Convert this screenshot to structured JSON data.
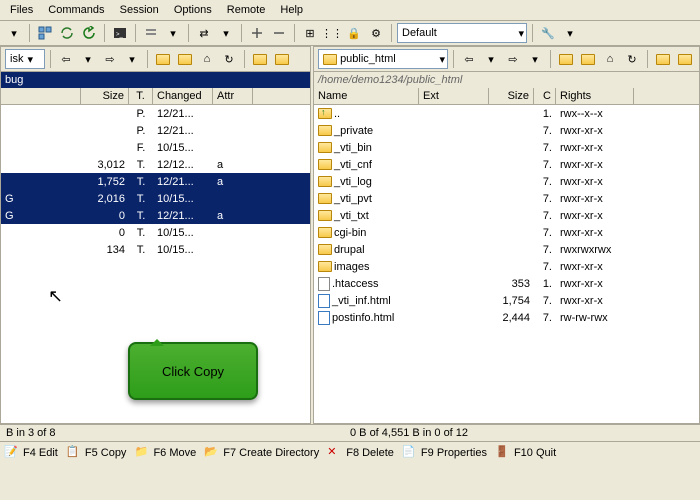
{
  "menu": [
    "Files",
    "Commands",
    "Session",
    "Options",
    "Remote",
    "Help"
  ],
  "session_dropdown": "Default",
  "left": {
    "disk": "isk",
    "path": "bug",
    "headers": {
      "size": "Size",
      "t": "T.",
      "changed": "Changed",
      "attr": "Attr"
    },
    "rows": [
      {
        "name": "",
        "size": "",
        "t": "P.",
        "chg": "12/21...",
        "attr": "",
        "sel": false
      },
      {
        "name": "",
        "size": "",
        "t": "P.",
        "chg": "12/21...",
        "attr": "",
        "sel": false
      },
      {
        "name": "",
        "size": "",
        "t": "F.",
        "chg": "10/15...",
        "attr": "",
        "sel": false
      },
      {
        "name": "",
        "size": "3,012",
        "t": "T.",
        "chg": "12/12...",
        "attr": "a",
        "sel": false
      },
      {
        "name": "",
        "size": "1,752",
        "t": "T.",
        "chg": "12/21...",
        "attr": "a",
        "sel": true
      },
      {
        "name": "G",
        "size": "2,016",
        "t": "T.",
        "chg": "10/15...",
        "attr": "",
        "sel": true
      },
      {
        "name": "G",
        "size": "0",
        "t": "T.",
        "chg": "12/21...",
        "attr": "a",
        "sel": true
      },
      {
        "name": "",
        "size": "0",
        "t": "T.",
        "chg": "10/15...",
        "attr": "",
        "sel": false
      },
      {
        "name": "",
        "size": "134",
        "t": "T.",
        "chg": "10/15...",
        "attr": "",
        "sel": false
      }
    ],
    "status": "B in 3 of 8"
  },
  "right": {
    "folder": "public_html",
    "path": "/home/demo1234/public_html",
    "headers": {
      "name": "Name",
      "ext": "Ext",
      "size": "Size",
      "c": "C",
      "rights": "Rights"
    },
    "rows": [
      {
        "ico": "up",
        "name": "..",
        "size": "",
        "c": "1.",
        "rights": "rwx--x--x"
      },
      {
        "ico": "f",
        "name": "_private",
        "size": "",
        "c": "7.",
        "rights": "rwxr-xr-x"
      },
      {
        "ico": "f",
        "name": "_vti_bin",
        "size": "",
        "c": "7.",
        "rights": "rwxr-xr-x"
      },
      {
        "ico": "f",
        "name": "_vti_cnf",
        "size": "",
        "c": "7.",
        "rights": "rwxr-xr-x"
      },
      {
        "ico": "f",
        "name": "_vti_log",
        "size": "",
        "c": "7.",
        "rights": "rwxr-xr-x"
      },
      {
        "ico": "f",
        "name": "_vti_pvt",
        "size": "",
        "c": "7.",
        "rights": "rwxr-xr-x"
      },
      {
        "ico": "f",
        "name": "_vti_txt",
        "size": "",
        "c": "7.",
        "rights": "rwxr-xr-x"
      },
      {
        "ico": "f",
        "name": "cgi-bin",
        "size": "",
        "c": "7.",
        "rights": "rwxr-xr-x"
      },
      {
        "ico": "f",
        "name": "drupal",
        "size": "",
        "c": "7.",
        "rights": "rwxrwxrwx"
      },
      {
        "ico": "f",
        "name": "images",
        "size": "",
        "c": "7.",
        "rights": "rwxr-xr-x"
      },
      {
        "ico": "file",
        "name": ".htaccess",
        "size": "353",
        "c": "1.",
        "rights": "rwxr-xr-x"
      },
      {
        "ico": "html",
        "name": "_vti_inf.html",
        "size": "1,754",
        "c": "7.",
        "rights": "rwxr-xr-x"
      },
      {
        "ico": "html",
        "name": "postinfo.html",
        "size": "2,444",
        "c": "7.",
        "rights": "rw-rw-rwx"
      }
    ],
    "status": "0 B of 4,551 B in 0 of 12"
  },
  "fkeys": [
    {
      "k": "F4 Edit"
    },
    {
      "k": "F5 Copy"
    },
    {
      "k": "F6 Move"
    },
    {
      "k": "F7 Create Directory"
    },
    {
      "k": "F8 Delete"
    },
    {
      "k": "F9 Properties"
    },
    {
      "k": "F10 Quit"
    }
  ],
  "callout": "Click Copy"
}
